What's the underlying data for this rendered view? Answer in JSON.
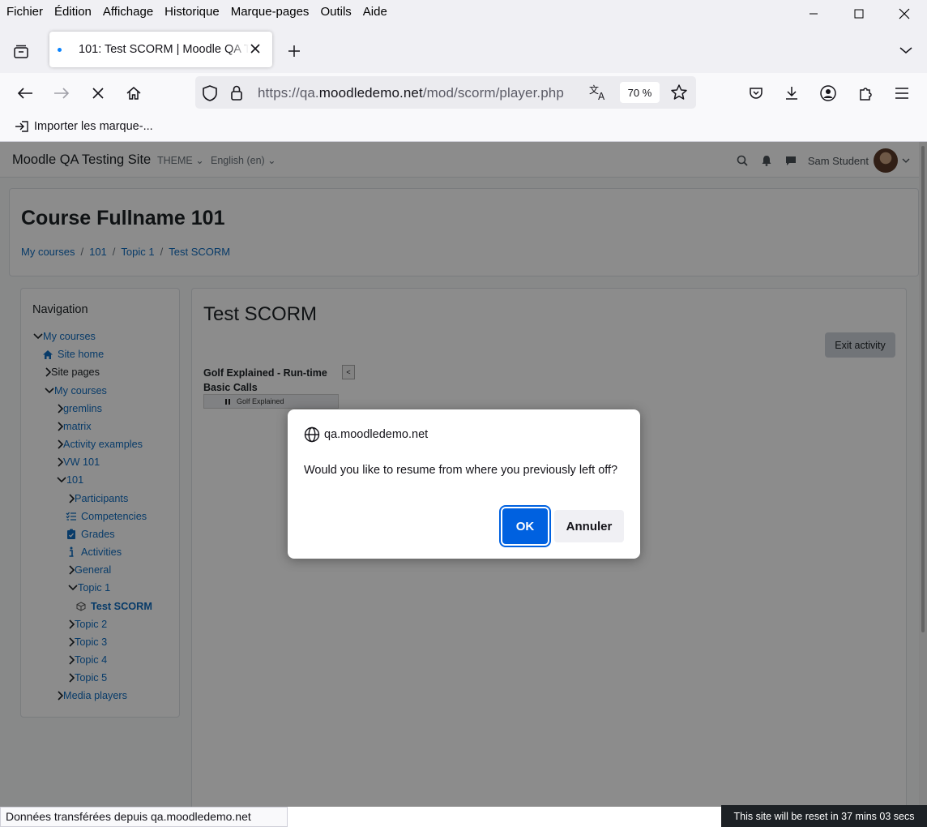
{
  "browser": {
    "menu": [
      "Fichier",
      "Édition",
      "Affichage",
      "Historique",
      "Marque-pages",
      "Outils",
      "Aide"
    ],
    "tab_title": "101: Test SCORM | Moodle QA Testing Site",
    "url_prefix": "https://qa.",
    "url_domain": "moodledemo.net",
    "url_path": "/mod/scorm/player.php",
    "zoom": "70 %",
    "bookmark_import": "Importer les marque-..."
  },
  "moodle": {
    "site_name": "Moodle QA Testing Site",
    "theme_label": "THEME",
    "language_label": "English (en)",
    "user_name": "Sam Student",
    "course_title": "Course Fullname 101",
    "breadcrumb": [
      "My courses",
      "101",
      "Topic 1",
      "Test SCORM"
    ],
    "navigation": {
      "heading": "Navigation",
      "items": [
        "My courses",
        "Site home",
        "Site pages",
        "My courses",
        "gremlins",
        "matrix",
        "Activity examples",
        "VW 101",
        "101",
        "Participants",
        "Competencies",
        "Grades",
        "Activities",
        "General",
        "Topic 1",
        "Test SCORM",
        "Topic 2",
        "Topic 3",
        "Topic 4",
        "Topic 5",
        "Media players"
      ]
    },
    "activity_title": "Test SCORM",
    "exit_button": "Exit activity",
    "toc_title": "Golf Explained - Run-time Basic Calls",
    "toc_toggle": "<",
    "toc_item": "Golf Explained"
  },
  "dialog": {
    "origin": "qa.moodledemo.net",
    "message": "Would you like to resume from where you previously left off?",
    "ok": "OK",
    "cancel": "Annuler"
  },
  "status": {
    "left": "Données transférées depuis qa.moodledemo.net",
    "right": "This site will be reset in 37 mins 03 secs"
  }
}
